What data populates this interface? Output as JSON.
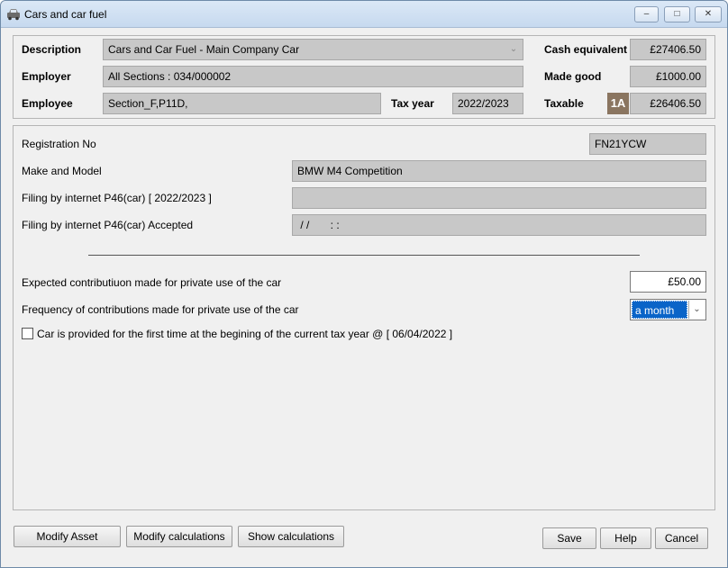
{
  "window": {
    "title": "Cars and car fuel",
    "controls": {
      "minimize": "–",
      "maximize": "□",
      "close": "✕"
    }
  },
  "header": {
    "description_label": "Description",
    "description_value": "Cars and Car Fuel - Main Company Car",
    "employer_label": "Employer",
    "employer_value": "All Sections : 034/000002",
    "employee_label": "Employee",
    "employee_value": "Section_F,P11D,",
    "tax_year_label": "Tax year",
    "tax_year_value": "2022/2023",
    "cash_equivalent_label": "Cash equivalent",
    "cash_equivalent_value": "£27406.50",
    "made_good_label": "Made good",
    "made_good_value": "£1000.00",
    "taxable_label": "Taxable",
    "taxable_badge": "1A",
    "taxable_value": "£26406.50"
  },
  "details": {
    "registration_label": "Registration No",
    "registration_value": "FN21YCW",
    "make_model_label": "Make and Model",
    "make_model_value": "BMW M4 Competition",
    "filing_label": "Filing by internet P46(car) [ 2022/2023 ]",
    "filing_value": "",
    "filing_accepted_label": "Filing by internet P46(car) Accepted",
    "filing_accepted_value": " / /       : :",
    "contribution_label": "Expected contributiuon made for private use of the car",
    "contribution_value": "£50.00",
    "frequency_label": "Frequency of contributions made for private use of the car",
    "frequency_value": "a month",
    "first_time_label": "Car is provided for the first time at the begining of the current tax year @ [ 06/04/2022 ]"
  },
  "footer": {
    "modify_asset": "Modify Asset",
    "modify_calculations": "Modify calculations",
    "show_calculations": "Show calculations",
    "save": "Save",
    "help": "Help",
    "cancel": "Cancel"
  }
}
